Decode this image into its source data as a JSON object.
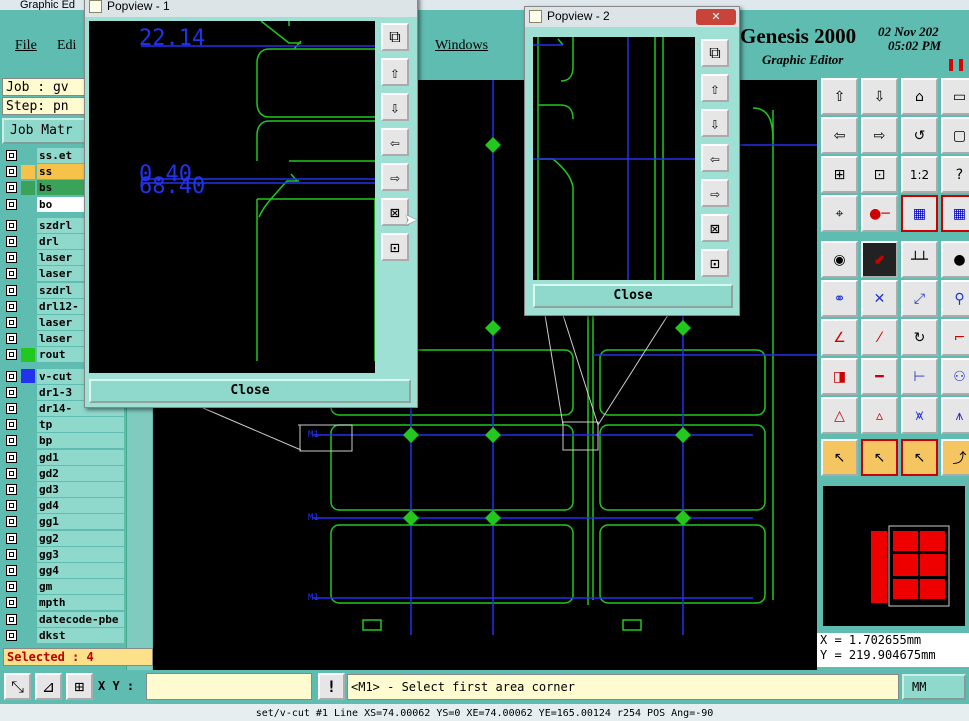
{
  "window": {
    "title": "Graphic Ed"
  },
  "menu": {
    "file": "File",
    "edit": "Edi",
    "windows": "Windows"
  },
  "brand": {
    "name": "Genesis 2000",
    "subtitle": "Graphic Editor",
    "date": "02 Nov 202",
    "time": "05:02 PM"
  },
  "job": {
    "job_label": "Job : gv",
    "step_label": "Step: pn",
    "matrix_button": "Job Matr"
  },
  "layers": [
    {
      "name": "ss.et",
      "color": "",
      "highlight": false
    },
    {
      "name": "ss",
      "color": "#f7c24a",
      "highlight": true
    },
    {
      "name": "bs",
      "color": "#3aa35a",
      "highlight": true
    },
    {
      "name": "bo",
      "color": "",
      "highlight": false
    },
    {
      "name": "szdrl",
      "color": "",
      "highlight": false
    },
    {
      "name": "drl",
      "color": "",
      "highlight": false
    },
    {
      "name": "laser",
      "color": "",
      "highlight": false
    },
    {
      "name": "laser",
      "color": "",
      "highlight": false
    },
    {
      "name": "szdrl",
      "color": "",
      "highlight": false
    },
    {
      "name": "drl12-",
      "color": "",
      "highlight": false
    },
    {
      "name": "laser",
      "color": "",
      "highlight": false
    },
    {
      "name": "laser",
      "color": "",
      "highlight": false
    },
    {
      "name": "rout",
      "color": "#22c81e",
      "highlight": false
    },
    {
      "name": "v-cut",
      "color": "#2233ee",
      "highlight": false
    },
    {
      "name": "dr1-3",
      "color": "",
      "highlight": false
    },
    {
      "name": "dr14-",
      "color": "",
      "highlight": false
    },
    {
      "name": "tp",
      "color": "",
      "highlight": false
    },
    {
      "name": "bp",
      "color": "",
      "highlight": false
    },
    {
      "name": "gd1",
      "color": "",
      "highlight": false
    },
    {
      "name": "gd2",
      "color": "",
      "highlight": false
    },
    {
      "name": "gd3",
      "color": "",
      "highlight": false
    },
    {
      "name": "gd4",
      "color": "",
      "highlight": false
    },
    {
      "name": "gg1",
      "color": "",
      "highlight": false
    },
    {
      "name": "gg2",
      "color": "",
      "highlight": false
    },
    {
      "name": "gg3",
      "color": "",
      "highlight": false
    },
    {
      "name": "gg4",
      "color": "",
      "highlight": false
    },
    {
      "name": "gm",
      "color": "",
      "highlight": false
    },
    {
      "name": "mpth",
      "color": "",
      "highlight": false
    },
    {
      "name": "datecode-pbe",
      "color": "",
      "highlight": false
    },
    {
      "name": "dkst",
      "color": "",
      "highlight": false
    }
  ],
  "selected": "Selected : 4",
  "coords": {
    "x": "X =  1.702655mm",
    "y": "Y = 219.904675mm"
  },
  "bottom": {
    "xy_label": "X Y :",
    "prompt": "<M1> - Select first area corner",
    "unit": "MM",
    "status": "set/v-cut #1 Line XS=74.00062 YS=0 XE=74.00062 YE=165.00124 r254 POS Ang=-90"
  },
  "popview1": {
    "title": "Popview - 1",
    "close_label": "Close",
    "measure_top": "22.14",
    "measure_mid1": "0.40",
    "measure_mid2": "68.40"
  },
  "popview2": {
    "title": "Popview - 2",
    "close_label": "Close"
  },
  "colors": {
    "teal": "#5fbcb0",
    "canvas": "#000000",
    "route": "#22c81e",
    "vcut": "#2233ee"
  }
}
